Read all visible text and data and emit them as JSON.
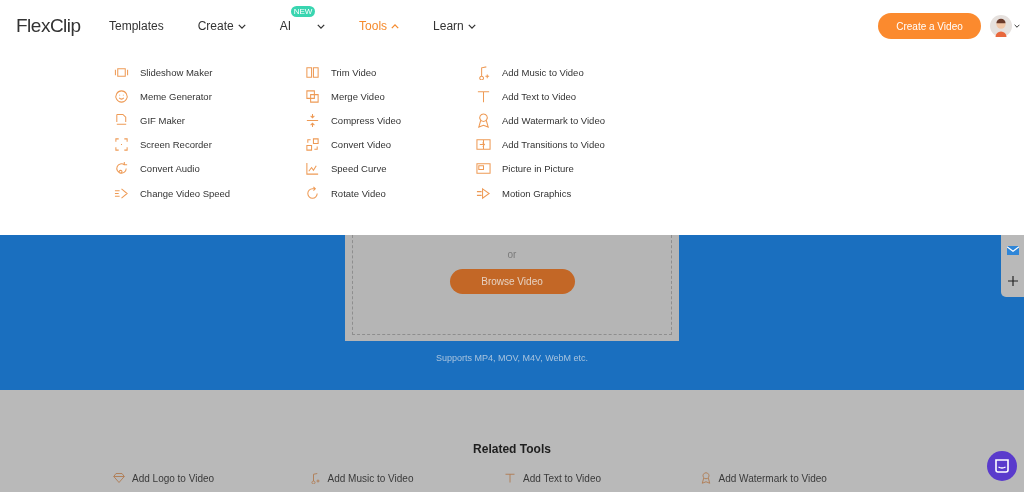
{
  "header": {
    "logo": "FlexClip",
    "nav": [
      {
        "label": "Templates",
        "kind": "link",
        "selected": false
      },
      {
        "label": "Create",
        "kind": "dropdown",
        "selected": false
      },
      {
        "label": "AI",
        "kind": "dropdown",
        "selected": false,
        "badge": "NEW"
      },
      {
        "label": "Tools",
        "kind": "dropdown",
        "selected": true
      },
      {
        "label": "Learn",
        "kind": "dropdown",
        "selected": false
      }
    ],
    "cta": "Create a Video"
  },
  "tools_menu": {
    "columns": [
      [
        "Slideshow Maker",
        "Meme Generator",
        "GIF Maker",
        "Screen Recorder",
        "Convert Audio",
        "Change Video Speed"
      ],
      [
        "Trim Video",
        "Merge Video",
        "Compress Video",
        "Convert Video",
        "Speed Curve",
        "Rotate Video"
      ],
      [
        "Add Music to Video",
        "Add Text to Video",
        "Add Watermark to Video",
        "Add Transitions to Video",
        "Picture in Picture",
        "Motion Graphics"
      ]
    ]
  },
  "upload": {
    "separator": "or",
    "button": "Browse Video",
    "formats": "Supports MP4, MOV, M4V, WebM etc."
  },
  "related": {
    "title": "Related Tools",
    "items": [
      "Add Logo to Video",
      "Add Music to Video",
      "Add Text to Video",
      "Add Watermark to Video"
    ]
  }
}
